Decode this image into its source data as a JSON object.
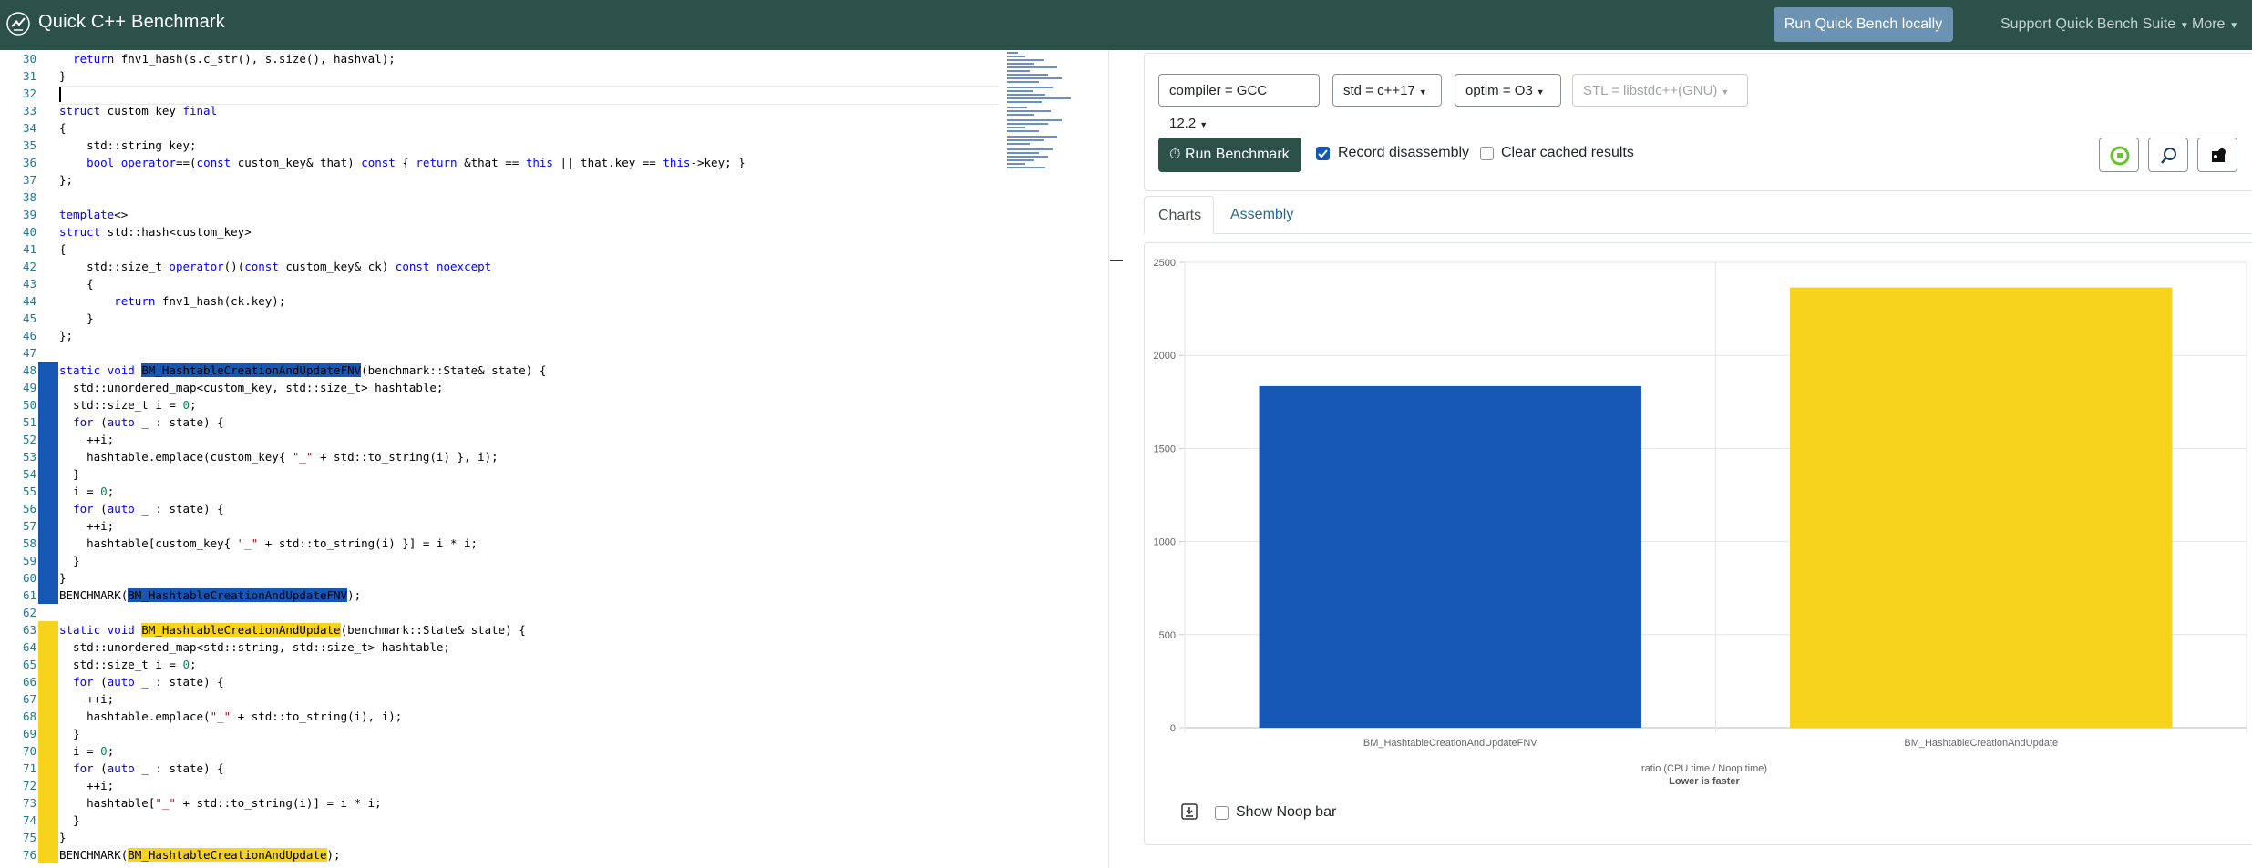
{
  "navbar": {
    "title": "Quick C++ Benchmark",
    "run_local": "Run Quick Bench locally",
    "support": "Support Quick Bench Suite",
    "more": "More"
  },
  "editor": {
    "lines": [
      {
        "n": "30",
        "t": "  return fnv1_hash(s.c_str(), s.size(), hashval);"
      },
      {
        "n": "31",
        "t": "}"
      },
      {
        "n": "32",
        "t": ""
      },
      {
        "n": "33",
        "t": "struct custom_key final"
      },
      {
        "n": "34",
        "t": "{"
      },
      {
        "n": "35",
        "t": "    std::string key;"
      },
      {
        "n": "36",
        "t": "    bool operator==(const custom_key& that) const { return &that == this || that.key == this->key; }"
      },
      {
        "n": "37",
        "t": "};"
      },
      {
        "n": "38",
        "t": ""
      },
      {
        "n": "39",
        "t": "template<>"
      },
      {
        "n": "40",
        "t": "struct std::hash<custom_key>"
      },
      {
        "n": "41",
        "t": "{"
      },
      {
        "n": "42",
        "t": "    std::size_t operator()(const custom_key& ck) const noexcept"
      },
      {
        "n": "43",
        "t": "    {"
      },
      {
        "n": "44",
        "t": "        return fnv1_hash(ck.key);"
      },
      {
        "n": "45",
        "t": "    }"
      },
      {
        "n": "46",
        "t": "};"
      },
      {
        "n": "47",
        "t": ""
      },
      {
        "n": "48",
        "t": "static void BM_HashtableCreationAndUpdateFNV(benchmark::State& state) {"
      },
      {
        "n": "49",
        "t": "  std::unordered_map<custom_key, std::size_t> hashtable;"
      },
      {
        "n": "50",
        "t": "  std::size_t i = 0;"
      },
      {
        "n": "51",
        "t": "  for (auto _ : state) {"
      },
      {
        "n": "52",
        "t": "    ++i;"
      },
      {
        "n": "53",
        "t": "    hashtable.emplace(custom_key{ \"_\" + std::to_string(i) }, i);"
      },
      {
        "n": "54",
        "t": "  }"
      },
      {
        "n": "55",
        "t": "  i = 0;"
      },
      {
        "n": "56",
        "t": "  for (auto _ : state) {"
      },
      {
        "n": "57",
        "t": "    ++i;"
      },
      {
        "n": "58",
        "t": "    hashtable[custom_key{ \"_\" + std::to_string(i) }] = i * i;"
      },
      {
        "n": "59",
        "t": "  }"
      },
      {
        "n": "60",
        "t": "}"
      },
      {
        "n": "61",
        "t": "BENCHMARK(BM_HashtableCreationAndUpdateFNV);"
      },
      {
        "n": "62",
        "t": ""
      },
      {
        "n": "63",
        "t": "static void BM_HashtableCreationAndUpdate(benchmark::State& state) {"
      },
      {
        "n": "64",
        "t": "  std::unordered_map<std::string, std::size_t> hashtable;"
      },
      {
        "n": "65",
        "t": "  std::size_t i = 0;"
      },
      {
        "n": "66",
        "t": "  for (auto _ : state) {"
      },
      {
        "n": "67",
        "t": "    ++i;"
      },
      {
        "n": "68",
        "t": "    hashtable.emplace(\"_\" + std::to_string(i), i);"
      },
      {
        "n": "69",
        "t": "  }"
      },
      {
        "n": "70",
        "t": "  i = 0;"
      },
      {
        "n": "71",
        "t": "  for (auto _ : state) {"
      },
      {
        "n": "72",
        "t": "    ++i;"
      },
      {
        "n": "73",
        "t": "    hashtable[\"_\" + std::to_string(i)] = i * i;"
      },
      {
        "n": "74",
        "t": "  }"
      },
      {
        "n": "75",
        "t": "}"
      },
      {
        "n": "76",
        "t": "BENCHMARK(BM_HashtableCreationAndUpdate);"
      }
    ]
  },
  "toolbar": {
    "compiler": "compiler = GCC 12.2",
    "std": "std = c++17",
    "optim": "optim = O3",
    "stl": "STL = libstdc++(GNU)",
    "run_benchmark": "Run Benchmark",
    "record_disassembly": "Record disassembly",
    "record_disassembly_checked": true,
    "clear_cached": "Clear cached results",
    "clear_cached_checked": false
  },
  "tabs": [
    {
      "label": "Charts",
      "active": true
    },
    {
      "label": "Assembly",
      "active": false
    }
  ],
  "chart_data": {
    "type": "bar",
    "categories": [
      "BM_HashtableCreationAndUpdateFNV",
      "BM_HashtableCreationAndUpdate"
    ],
    "values": [
      1835,
      2365
    ],
    "colors": [
      "#1657b3",
      "#f7d31b"
    ],
    "xlabel": "ratio (CPU time / Noop time)",
    "xlabel_sub": "Lower is faster",
    "ylabel": "",
    "ylim": [
      0,
      2500
    ],
    "yticks": [
      "0",
      "500",
      "1000",
      "1500",
      "2000",
      "2500"
    ],
    "grid": true,
    "legend": "none"
  },
  "footer": {
    "show_noop": "Show Noop bar",
    "show_noop_checked": false
  }
}
